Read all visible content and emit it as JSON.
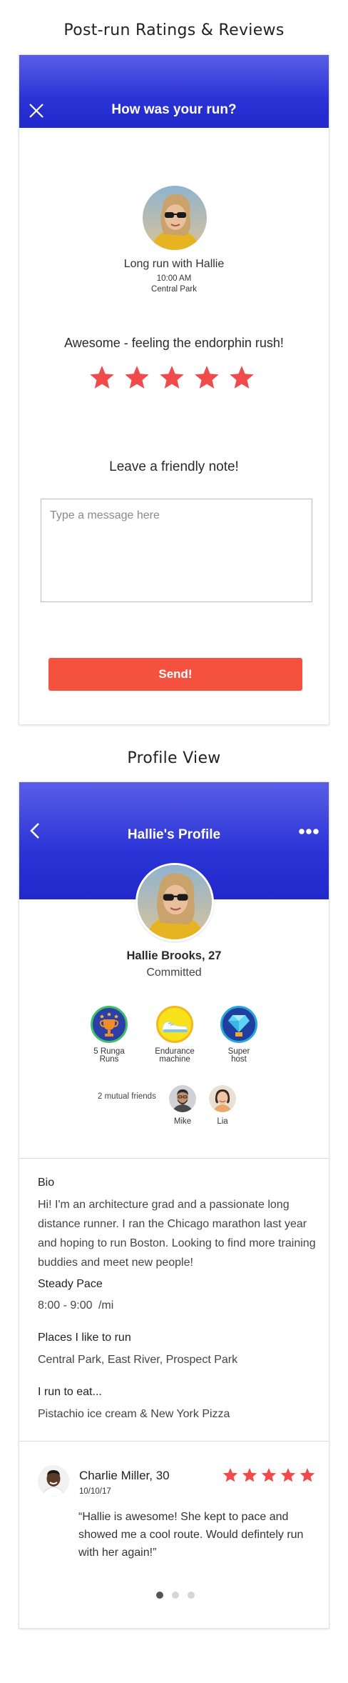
{
  "sections": {
    "rating_title": "Post-run Ratings & Reviews",
    "profile_title": "Profile View"
  },
  "rating": {
    "header_title": "How was your run?",
    "close_icon": "close-icon",
    "run_title": "Long run with Hallie",
    "run_time": "10:00 AM",
    "run_location": "Central Park",
    "rating_text": "Awesome - feeling the endorphin rush!",
    "stars": 5,
    "note_heading": "Leave a friendly note!",
    "message_placeholder": "Type a message here",
    "message_value": "",
    "send_label": "Send!"
  },
  "profile": {
    "header_title": "Hallie's Profile",
    "back_icon": "chevron-left-icon",
    "more_icon": "more-dots-icon",
    "name": "Hallie Brooks, 27",
    "status": "Committed",
    "badges": [
      {
        "label_line1": "5 Runga",
        "label_line2": "Runs",
        "icon": "trophy-icon"
      },
      {
        "label_line1": "Endurance",
        "label_line2": "machine",
        "icon": "sneaker-icon"
      },
      {
        "label_line1": "Super",
        "label_line2": "host",
        "icon": "diamond-icon"
      }
    ],
    "mutual_friends_label": "2 mutual friends",
    "friends": [
      {
        "name": "Mike"
      },
      {
        "name": "Lia"
      }
    ],
    "bio_label": "Bio",
    "bio_text": "Hi! I'm an architecture grad and a passionate long distance runner. I ran the Chicago marathon last year and hoping to run Boston. Looking to find more training buddies and meet new people!",
    "pace_label": "Steady Pace",
    "pace_value": "8:00 - 9:00",
    "pace_unit": "/mi",
    "places_label": "Places I like to run",
    "places_value": "Central Park, East River, Prospect Park",
    "eat_label": "I run to eat...",
    "eat_value": "Pistachio ice cream & New York Pizza",
    "review": {
      "author": "Charlie Miller, 30",
      "date": "10/10/17",
      "stars": 5,
      "text": "“Hallie is awesome! She kept to pace and showed me a cool route. Would defintely run with her again!”"
    },
    "pagination": {
      "count": 3,
      "active": 1
    }
  },
  "colors": {
    "header_gradient_top": "#5a5ee6",
    "header_gradient_bottom": "#2128cc",
    "star": "#f04a4a",
    "send_button": "#f5513f"
  }
}
